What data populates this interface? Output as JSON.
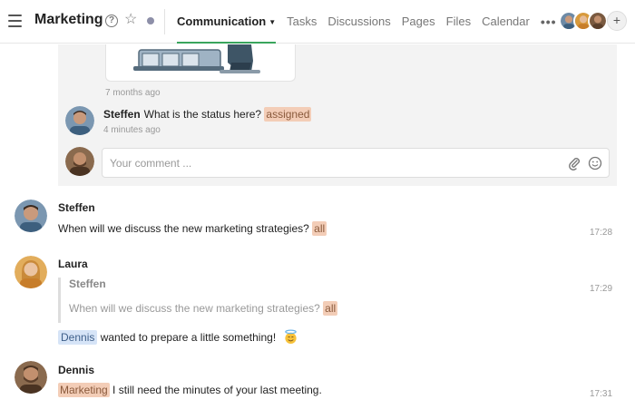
{
  "header": {
    "title": "Marketing",
    "help_icon": "question-circle-icon",
    "star_icon": "star-outline-icon",
    "status_dot_color": "#8d8fa8",
    "nav": [
      {
        "label": "Communication",
        "active": true
      },
      {
        "label": "Tasks"
      },
      {
        "label": "Discussions"
      },
      {
        "label": "Pages"
      },
      {
        "label": "Files"
      },
      {
        "label": "Calendar"
      }
    ],
    "more_label": "•••",
    "add_member_label": "+"
  },
  "thread": {
    "image_timestamp": "7 months ago",
    "reply": {
      "author": "Steffen",
      "text": "What is the status here?",
      "tag": "assigned",
      "time": "4 minutes ago"
    },
    "comment_placeholder": "Your comment ...",
    "attach_icon": "paperclip-icon",
    "emoji_icon": "smiley-icon"
  },
  "messages": [
    {
      "author": "Steffen",
      "text": "When will we discuss the new marketing strategies?",
      "tag": "all",
      "time": "17:28"
    },
    {
      "author": "Laura",
      "quote_author": "Steffen",
      "quote_text": "When will we discuss the new marketing strategies?",
      "quote_tag": "all",
      "mention": "Dennis",
      "text": "wanted to prepare a little something!",
      "emoji": "smiling-face-with-halo",
      "time": "17:29"
    },
    {
      "author": "Dennis",
      "mention": "Marketing",
      "text": "I still need the minutes of your last meeting.",
      "time": "17:31"
    }
  ],
  "colors": {
    "accent_green": "#3aa55d",
    "tag_orange_bg": "#f3cdb7",
    "tag_blue_bg": "#d6e4f7",
    "thread_bg": "#f3f3f3"
  }
}
